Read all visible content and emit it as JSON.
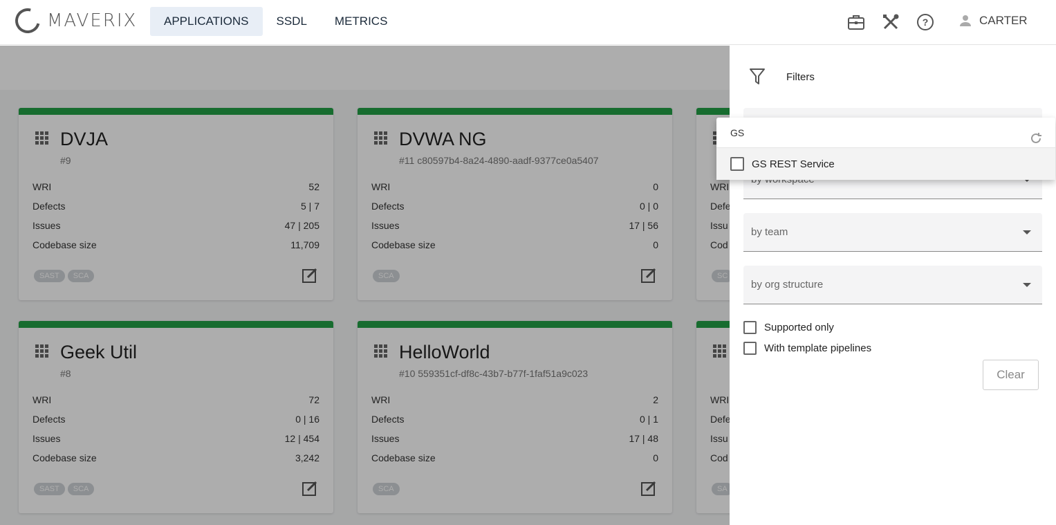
{
  "header": {
    "logo_text": "MAVERIX",
    "nav": [
      {
        "label": "APPLICATIONS",
        "active": true
      },
      {
        "label": "SSDL",
        "active": false
      },
      {
        "label": "METRICS",
        "active": false
      }
    ],
    "icons": [
      "briefcase-icon",
      "tools-icon",
      "help-icon"
    ],
    "user_name": "CARTER"
  },
  "cards": [
    {
      "title": "DVJA",
      "id": "#9",
      "metrics": [
        {
          "label": "WRI",
          "value": "52"
        },
        {
          "label": "Defects",
          "value": "5 | 7"
        },
        {
          "label": "Issues",
          "value": "47 | 205"
        },
        {
          "label": "Codebase size",
          "value": "11,709"
        }
      ],
      "chips": [
        "SAST",
        "SCA"
      ]
    },
    {
      "title": "DVWA NG",
      "id": "#11 c80597b4-8a24-4890-aadf-9377ce0a5407",
      "metrics": [
        {
          "label": "WRI",
          "value": "0"
        },
        {
          "label": "Defects",
          "value": "0 | 0"
        },
        {
          "label": "Issues",
          "value": "17 | 56"
        },
        {
          "label": "Codebase size",
          "value": "0"
        }
      ],
      "chips": [
        "SCA"
      ]
    },
    {
      "title": "",
      "id": "",
      "metrics": [
        {
          "label": "WRI",
          "value": ""
        },
        {
          "label": "Defe",
          "value": ""
        },
        {
          "label": "Issu",
          "value": ""
        },
        {
          "label": "Cod",
          "value": ""
        }
      ],
      "chips": [
        "SC"
      ]
    },
    {
      "title": "Geek Util",
      "id": "#8",
      "metrics": [
        {
          "label": "WRI",
          "value": "72"
        },
        {
          "label": "Defects",
          "value": "0 | 16"
        },
        {
          "label": "Issues",
          "value": "12 | 454"
        },
        {
          "label": "Codebase size",
          "value": "3,242"
        }
      ],
      "chips": [
        "SAST",
        "SCA"
      ]
    },
    {
      "title": "HelloWorld",
      "id": "#10 559351cf-df8c-43b7-b77f-1faf51a9c023",
      "metrics": [
        {
          "label": "WRI",
          "value": "2"
        },
        {
          "label": "Defects",
          "value": "0 | 1"
        },
        {
          "label": "Issues",
          "value": "17 | 48"
        },
        {
          "label": "Codebase size",
          "value": "0"
        }
      ],
      "chips": [
        "SCA"
      ]
    },
    {
      "title": "",
      "id": "",
      "metrics": [
        {
          "label": "WRI",
          "value": ""
        },
        {
          "label": "Defe",
          "value": ""
        },
        {
          "label": "Issu",
          "value": ""
        },
        {
          "label": "Cod",
          "value": ""
        }
      ],
      "chips": [
        "SA"
      ]
    }
  ],
  "filters": {
    "title": "Filters",
    "selects": [
      {
        "label": "by workspace"
      },
      {
        "label": "by team"
      },
      {
        "label": "by org structure"
      }
    ],
    "checkboxes": [
      {
        "label": "Supported only",
        "checked": false
      },
      {
        "label": "With template pipelines",
        "checked": false
      }
    ],
    "clear_label": "Clear"
  },
  "dropdown": {
    "search_value": "GS",
    "options": [
      {
        "label": "GS REST Service",
        "checked": false
      }
    ]
  },
  "colors": {
    "accent_green": "#22a046",
    "nav_active_bg": "#e8eef6"
  }
}
